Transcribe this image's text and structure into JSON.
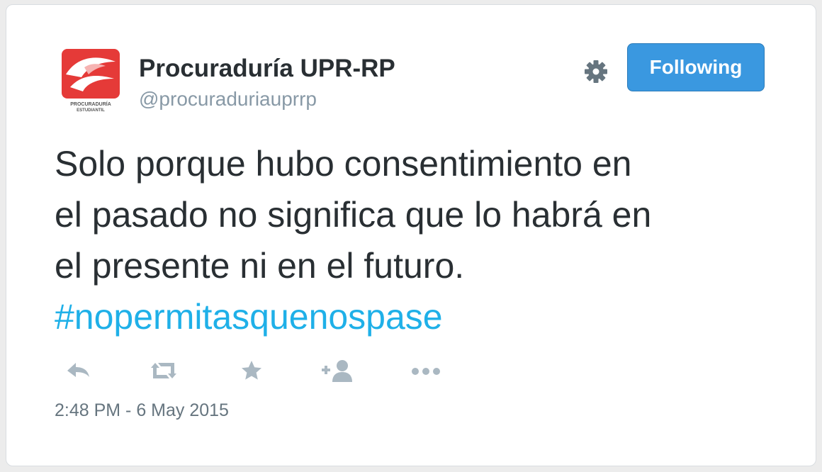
{
  "profile": {
    "display_name": "Procuraduría UPR-RP",
    "handle": "@procuraduriauprrp",
    "avatar_caption_top": "PROCURADURÍA",
    "avatar_caption_bottom": "ESTUDIANTIL"
  },
  "header": {
    "follow_label": "Following",
    "settings_icon": "gear-icon"
  },
  "tweet": {
    "lines": [
      "Solo porque hubo consentimiento en",
      "el pasado no significa que lo habrá en",
      "el presente ni en el futuro."
    ],
    "hashtag": "#nopermitasquenospase",
    "timestamp": "2:48 PM - 6 May 2015"
  },
  "actions": [
    {
      "icon": "reply-icon"
    },
    {
      "icon": "retweet-icon"
    },
    {
      "icon": "favorite-star-icon"
    },
    {
      "icon": "follow-user-icon"
    },
    {
      "icon": "more-options-icon"
    }
  ],
  "colors": {
    "accent_button": "#3a98e0",
    "hashtag": "#1fb0e8",
    "logo_red": "#e53a38",
    "icon_gray": "#aab8c2"
  }
}
